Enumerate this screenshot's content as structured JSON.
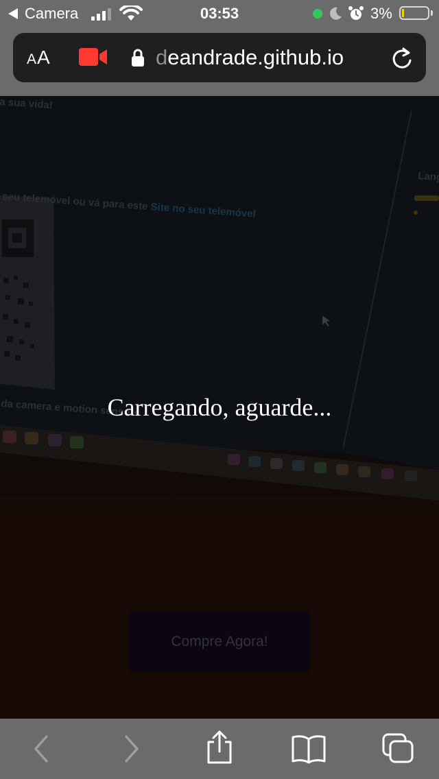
{
  "status_bar": {
    "back_app_label": "Camera",
    "time": "03:53",
    "battery_percent": "3%",
    "battery_level": 0.03,
    "signal_bars_active": 3,
    "signal_bars_total": 4,
    "camera_in_use_color": "#34c759",
    "icons": [
      "back-triangle-icon",
      "signal-icon",
      "wifi-icon",
      "camera-in-use-dot-icon",
      "moon-icon",
      "alarm-icon",
      "battery-icon"
    ]
  },
  "address_bar": {
    "text_size_label_small": "A",
    "text_size_label_large": "A",
    "url_faded": "d",
    "url_main": "eandrade.github.io",
    "icons": [
      "video-camera-icon",
      "lock-icon",
      "reload-icon"
    ],
    "video_icon_color": "#ff3b30"
  },
  "page": {
    "loading_text": "Carregando, aguarde...",
    "buy_button_label": "Compre Agora!",
    "camera_feed_text": {
      "line1": "seu telemóvel ou vá para este",
      "line1_link": "Site no seu telemóvel",
      "line2": "da camera e motion sensors",
      "line3": "a sua vida!",
      "line4": "Lang"
    }
  },
  "toolbar": {
    "icons": [
      "back-chevron-icon",
      "forward-chevron-icon",
      "share-icon",
      "bookmarks-icon",
      "tabs-icon"
    ]
  }
}
